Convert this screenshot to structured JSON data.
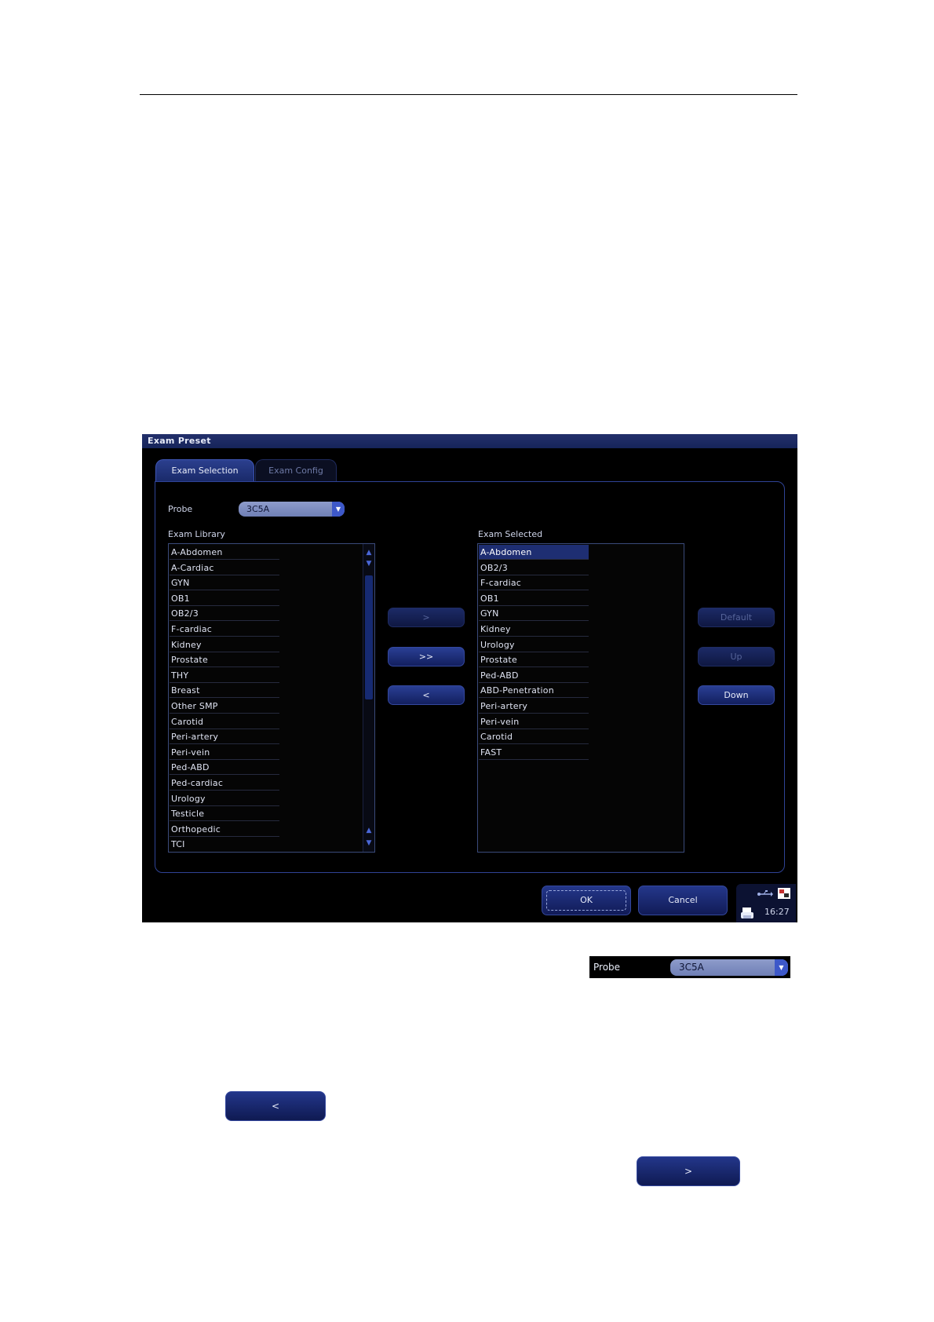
{
  "dialog": {
    "title": "Exam Preset",
    "tabs": [
      {
        "label": "Exam Selection"
      },
      {
        "label": "Exam Config"
      }
    ],
    "probe_label": "Probe",
    "probe_value": "3C5A",
    "library_label": "Exam Library",
    "selected_label": "Exam Selected",
    "library_items": [
      "A-Abdomen",
      "A-Cardiac",
      "GYN",
      "OB1",
      "OB2/3",
      "F-cardiac",
      "Kidney",
      "Prostate",
      "THY",
      "Breast",
      "Other SMP",
      "Carotid",
      "Peri-artery",
      "Peri-vein",
      "Ped-ABD",
      "Ped-cardiac",
      "Urology",
      "Testicle",
      "Orthopedic",
      "TCI"
    ],
    "selected_items": [
      "A-Abdomen",
      "OB2/3",
      "F-cardiac",
      "OB1",
      "GYN",
      "Kidney",
      "Urology",
      "Prostate",
      "Ped-ABD",
      "ABD-Penetration",
      "Peri-artery",
      "Peri-vein",
      "Carotid",
      "FAST"
    ],
    "transfer_buttons": {
      "add": ">",
      "add_all": ">>",
      "remove": "<"
    },
    "order_buttons": {
      "default": "Default",
      "up": "Up",
      "down": "Down"
    },
    "ok": "OK",
    "cancel": "Cancel",
    "clock": "16:27"
  },
  "snippets": {
    "probe_label": "Probe",
    "probe_value": "3C5A",
    "remove_button": "<",
    "add_button": ">"
  },
  "icons": [
    "chevron-down-icon",
    "scroll-up-icon",
    "scroll-down-icon",
    "usb-icon",
    "network-icon",
    "printer-icon"
  ],
  "colors": {
    "dialog_bg": "#000000",
    "titlebar": "#1c2a64",
    "button": "#1f318a",
    "accent": "#3d58c9"
  }
}
